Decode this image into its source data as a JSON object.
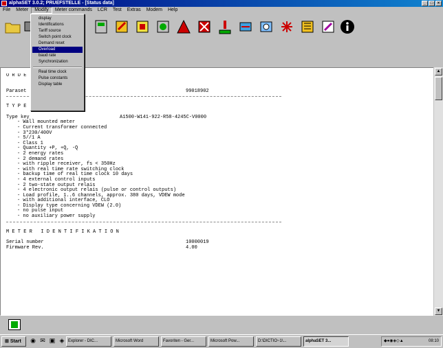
{
  "window": {
    "title": "alphaSET 3.0.2; PRUEFSTELLE - [Status data]"
  },
  "menubar": {
    "items": [
      "File",
      "Meter",
      "Modify",
      "Meter commands",
      "LCR",
      "Test",
      "Extras",
      "Modem",
      "Help"
    ]
  },
  "modify_menu": {
    "items": [
      "display",
      "Identifications",
      "Tariff source",
      "Switch point clock",
      "Demand reset",
      "Overload",
      "baud rate",
      "Synchronization",
      "Real time clock",
      "Pulse constants",
      "Display table"
    ],
    "highlighted": "Overload"
  },
  "toolbar": {
    "icons": [
      "open-folder-icon",
      "display-icon",
      "meter-icon",
      "wizard-icon",
      "identification-icon",
      "tariff-icon",
      "switch-clock-icon",
      "demand-icon",
      "overload-icon",
      "sync-icon",
      "clock-icon",
      "pulse-icon",
      "edit-icon",
      "info-icon"
    ]
  },
  "document": {
    "order_heading": "O R D E",
    "paraset_label": "Paraset",
    "paraset_value": "99018902",
    "type_key_heading": "T Y P E   K E Y",
    "type_key_label": "Type key",
    "type_key_value": "A1500-W141-922-R58-4245C-V0000",
    "features": [
      "- Wall mounted meter",
      "- Current transformer connected",
      "- 3*230/400V",
      "- 5//1 A",
      "- Class 1",
      "- Quantity +P, +Q, -Q",
      "- 2 energy rates",
      "- 2 demand rates",
      "- with ripple receiver, fs < 350Hz",
      "- with real time rate switching clock",
      "- backup time of real time clock 10 days",
      "- 4 external control inputs",
      "- 2 two-state output relais",
      "- 4 electronic output relais (pulse or control outputs)",
      "- Load profile, 1..6 channels, approx. 380 days, VDEW mode",
      "- with additional interface, CLO",
      "- Display type concerning VDEW (2.0)",
      "- no pulse input",
      "- no auxiliary power supply"
    ],
    "meter_id_heading": "M E T E R   I D E N T I F I K A T I O N",
    "serial_label": "Serial number",
    "serial_value": "10000019",
    "firmware_label": "Firmware Rev.",
    "firmware_value": "4.00"
  },
  "taskbar": {
    "start_label": "Start",
    "tasks": [
      "Explorer - DIC...",
      "Microsoft Word",
      "Favoriten - Ger...",
      "Microsoft Pow...",
      "D:\\DICTIO~1\\...",
      "alphaSET 3..."
    ],
    "clock": "08:10"
  }
}
